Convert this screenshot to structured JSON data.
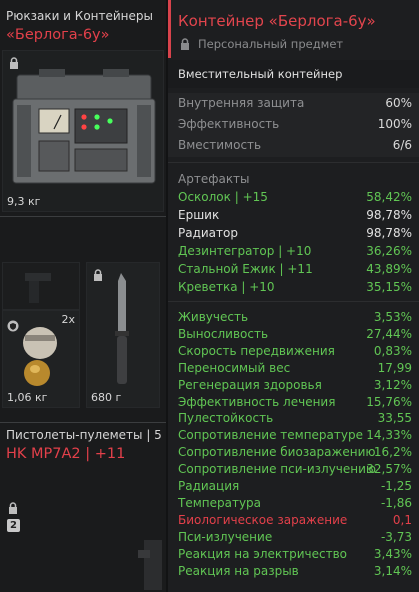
{
  "colors": {
    "accent_red": "#e2404a",
    "green": "#61c654",
    "white": "#e1e1e1",
    "grey": "#8f9092"
  },
  "left": {
    "category1": "Рюкзаки и Контейнеры",
    "item1_name": "«Берлога-6у»",
    "item1_weight": "9,3 кг",
    "item2_count": "2x",
    "item2_weight": "1,06 кг",
    "item3_weight": "680 г",
    "category2": "Пистолеты-пулеметы | 5",
    "item4_name": "HK MP7A2 | +11",
    "badge_num": "2"
  },
  "tooltip": {
    "title": "Контейнер «Берлога-6у»",
    "subtitle": "Персональный предмет",
    "type": "Вместительный контейнер",
    "props": [
      {
        "label": "Внутренняя защита",
        "value": "60%"
      },
      {
        "label": "Эффективность",
        "value": "100%"
      },
      {
        "label": "Вместимость",
        "value": "6/6"
      }
    ],
    "artifacts_title": "Артефакты",
    "artifacts": [
      {
        "label": "Осколок | +15",
        "value": "58,42%",
        "color": "green"
      },
      {
        "label": "Ершик",
        "value": "98,78%",
        "color": "white"
      },
      {
        "label": "Радиатор",
        "value": "98,78%",
        "color": "white"
      },
      {
        "label": "Дезинтегратор | +10",
        "value": "36,26%",
        "color": "green"
      },
      {
        "label": "Стальной Ежик | +11",
        "value": "43,89%",
        "color": "green"
      },
      {
        "label": "Креветка | +10",
        "value": "35,15%",
        "color": "green"
      }
    ],
    "stats": [
      {
        "label": "Живучесть",
        "value": "3,53%",
        "color": "green"
      },
      {
        "label": "Выносливость",
        "value": "27,44%",
        "color": "green"
      },
      {
        "label": "Скорость передвижения",
        "value": "0,83%",
        "color": "green"
      },
      {
        "label": "Переносимый вес",
        "value": "17,99",
        "color": "green"
      },
      {
        "label": "Регенерация здоровья",
        "value": "3,12%",
        "color": "green"
      },
      {
        "label": "Эффективность лечения",
        "value": "15,76%",
        "color": "green"
      },
      {
        "label": "Пулестойкость",
        "value": "33,55",
        "color": "green"
      },
      {
        "label": "Сопротивление температуре",
        "value": "14,33%",
        "color": "green"
      },
      {
        "label": "Сопротивление биозаражению",
        "value": "16,2%",
        "color": "green"
      },
      {
        "label": "Сопротивление пси-излучению",
        "value": "32,57%",
        "color": "green"
      },
      {
        "label": "Радиация",
        "value": "-1,25",
        "color": "green"
      },
      {
        "label": "Температура",
        "value": "-1,86",
        "color": "green"
      },
      {
        "label": "Биологическое заражение",
        "value": "0,1",
        "color": "red"
      },
      {
        "label": "Пси-излучение",
        "value": "-3,73",
        "color": "green"
      },
      {
        "label": "Реакция на электричество",
        "value": "3,43%",
        "color": "green"
      },
      {
        "label": "Реакция на разрыв",
        "value": "3,14%",
        "color": "green"
      }
    ]
  }
}
